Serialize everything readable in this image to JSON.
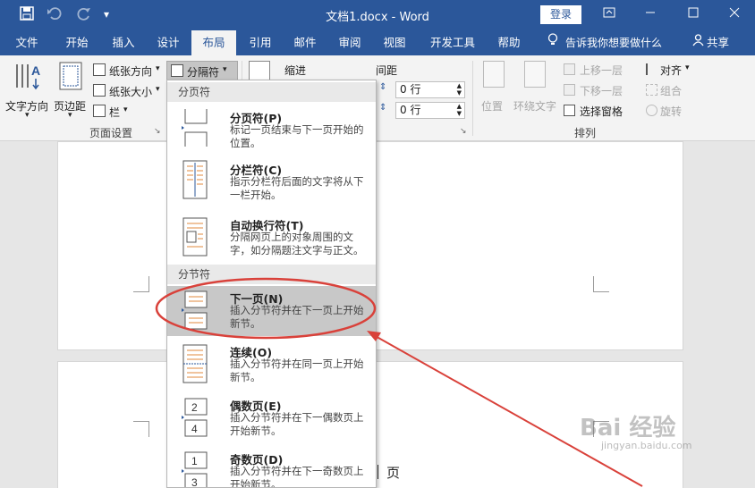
{
  "titlebar": {
    "title": "文档1.docx - Word",
    "login": "登录",
    "icons": [
      "save-icon",
      "undo-icon",
      "redo-icon",
      "customize-qat-icon",
      "ribbon-display-icon",
      "minimize-icon",
      "maximize-icon",
      "close-icon"
    ]
  },
  "tabs": [
    "文件",
    "开始",
    "插入",
    "设计",
    "布局",
    "引用",
    "邮件",
    "审阅",
    "视图",
    "开发工具",
    "帮助"
  ],
  "active_tab": "布局",
  "tell_me": "告诉我你想要做什么",
  "share": "共享",
  "ribbon": {
    "text_direction": "文字方向",
    "margins": "页边距",
    "orientation": "纸张方向",
    "size": "纸张大小",
    "columns": "栏",
    "breaks": "分隔符",
    "page_setup": "页面设置",
    "indent": "缩进",
    "spacing": "间距",
    "spacing_before": "0 行",
    "spacing_after": "0 行",
    "position": "位置",
    "wrap_text": "环绕文字",
    "bring_forward": "上移一层",
    "send_backward": "下移一层",
    "selection_pane": "选择窗格",
    "align": "对齐",
    "group": "组合",
    "rotate": "旋转",
    "arrange": "排列"
  },
  "dropdown": {
    "section_page_breaks": "分页符",
    "section_section_breaks": "分节符",
    "items": [
      {
        "title": "分页符(P)",
        "desc": "标记一页结束与下一页开始的位置。"
      },
      {
        "title": "分栏符(C)",
        "desc": "指示分栏符后面的文字将从下一栏开始。"
      },
      {
        "title": "自动换行符(T)",
        "desc": "分隔网页上的对象周围的文字，如分隔题注文字与正文。"
      },
      {
        "title": "下一页(N)",
        "desc": "插入分节符并在下一页上开始新节。"
      },
      {
        "title": "连续(O)",
        "desc": "插入分节符并在同一页上开始新节。"
      },
      {
        "title": "偶数页(E)",
        "desc": "插入分节符并在下一偶数页上开始新节。"
      },
      {
        "title": "奇数页(D)",
        "desc": "插入分节符并在下一奇数页上开始新节。"
      }
    ]
  },
  "doc": {
    "page_char": "页"
  },
  "watermark": {
    "main": "Bai 经验",
    "sub": "jingyan.baidu.com"
  },
  "colors": {
    "word_blue": "#2b579a",
    "highlight": "#c8c8c8",
    "annotation_red": "#d9413a"
  }
}
